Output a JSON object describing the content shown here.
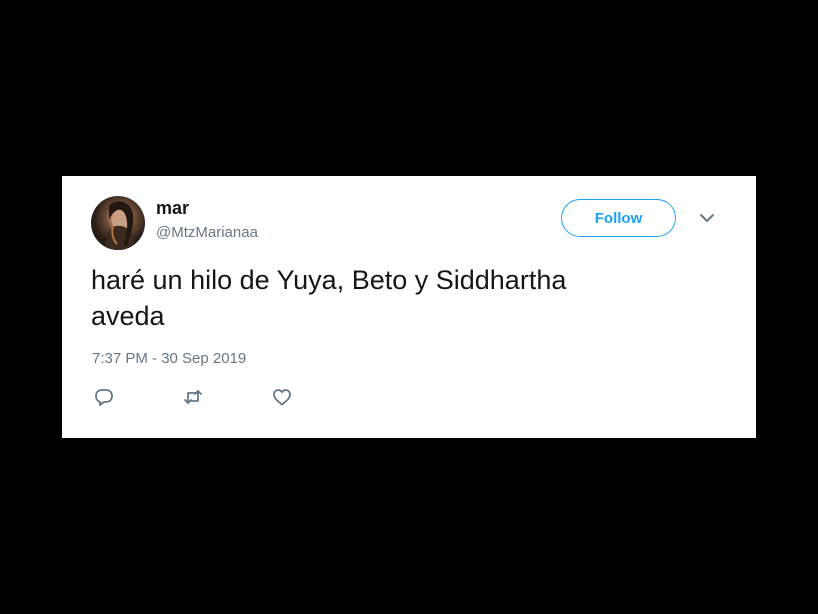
{
  "tweet": {
    "author": {
      "name": "mar",
      "handle": "@MtzMarianaa"
    },
    "follow_label": "Follow",
    "text_line1": "haré un hilo de Yuya, Beto y Siddhartha",
    "text_line2": "aveda",
    "timestamp": "7:37 PM - 30 Sep 2019",
    "icons": {
      "more": "chevron-down-icon",
      "reply": "reply-icon",
      "retweet": "retweet-icon",
      "like": "heart-icon"
    },
    "colors": {
      "accent": "#1da1f2",
      "secondary_text": "#657786",
      "primary_text": "#14171a",
      "background": "#000000",
      "card": "#ffffff"
    }
  }
}
